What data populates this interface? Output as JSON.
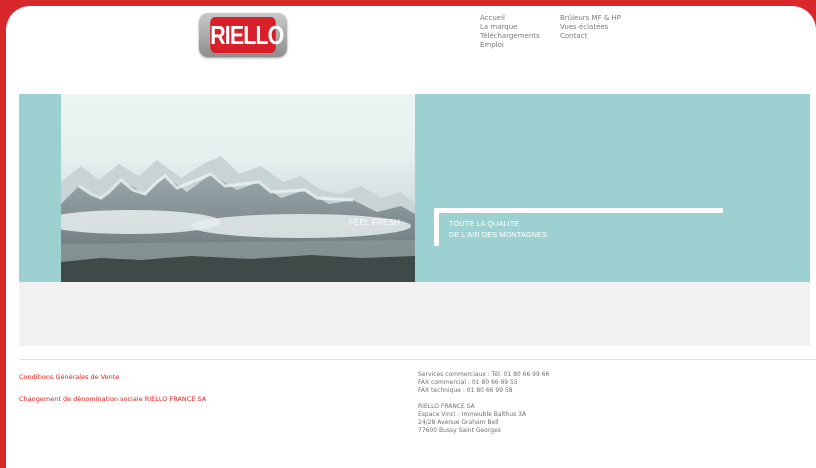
{
  "brand": {
    "logo_text": "RIELLO",
    "color": "#d7202a"
  },
  "nav": {
    "col1": [
      "Accueil",
      "La marque",
      "Téléchargements",
      "Emploi"
    ],
    "col2": [
      "Brûleurs MF & HP",
      "Vues éclatées",
      "Contact"
    ]
  },
  "hero": {
    "photo_caption": "FEEL FRESH",
    "tagline_line1": "TOUTE LA QUALITE",
    "tagline_line2": "DE L'AIR DES MONTAGNES",
    "accent_color": "#9dd0d0"
  },
  "footer": {
    "links": [
      "Conditions Générales de Vente",
      "Changement de dénomination sociale RIELLO FRANCE SA"
    ],
    "contacts": [
      "Services commerciaux : Tél. 01 80 66 99 66",
      "FAX commercial : 01 80 66 99 55",
      "FAX technique : 01 80 66 99 58"
    ],
    "address": [
      "RIELLO FRANCE SA",
      "Espace Vinci - Immeuble Balthus 3A",
      "24/28 Avenue Graham Bell",
      "77600  Bussy Saint Georges"
    ]
  }
}
